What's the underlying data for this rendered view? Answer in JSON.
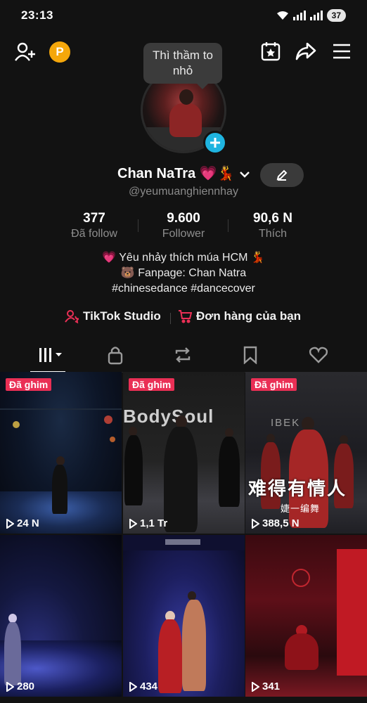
{
  "status_bar": {
    "time": "23:13",
    "battery": "37"
  },
  "tooltip": {
    "text": "Thì thầm to nhỏ"
  },
  "profile": {
    "name": "Chan NaTra 💗💃",
    "handle": "@yeumuanghiennhay",
    "stats": [
      {
        "value": "377",
        "label": "Đã follow"
      },
      {
        "value": "9.600",
        "label": "Follower"
      },
      {
        "value": "90,6 N",
        "label": "Thích"
      }
    ],
    "bio": [
      "💗 Yêu nhảy thích múa HCM 💃",
      "🐻 Fanpage: Chan Natra",
      "#chinesedance #dancecover"
    ],
    "links": {
      "studio": "TikTok Studio",
      "orders": "Đơn hàng của bạn"
    }
  },
  "videos": [
    {
      "pinned": "Đã ghim",
      "views": "24 N"
    },
    {
      "pinned": "Đã ghim",
      "views": "1,1 Tr",
      "overlay": "BodySoul"
    },
    {
      "pinned": "Đã ghim",
      "views": "388,5 N",
      "overlay": "难得有情人",
      "overlay_small": "婕一编舞",
      "overlay_top": "IBEK"
    },
    {
      "views": "280"
    },
    {
      "views": "434"
    },
    {
      "views": "341"
    }
  ],
  "colors": {
    "accent_pink": "#ea2f55",
    "accent_blue": "#1fb4e0",
    "coin": "#f5a70b"
  }
}
